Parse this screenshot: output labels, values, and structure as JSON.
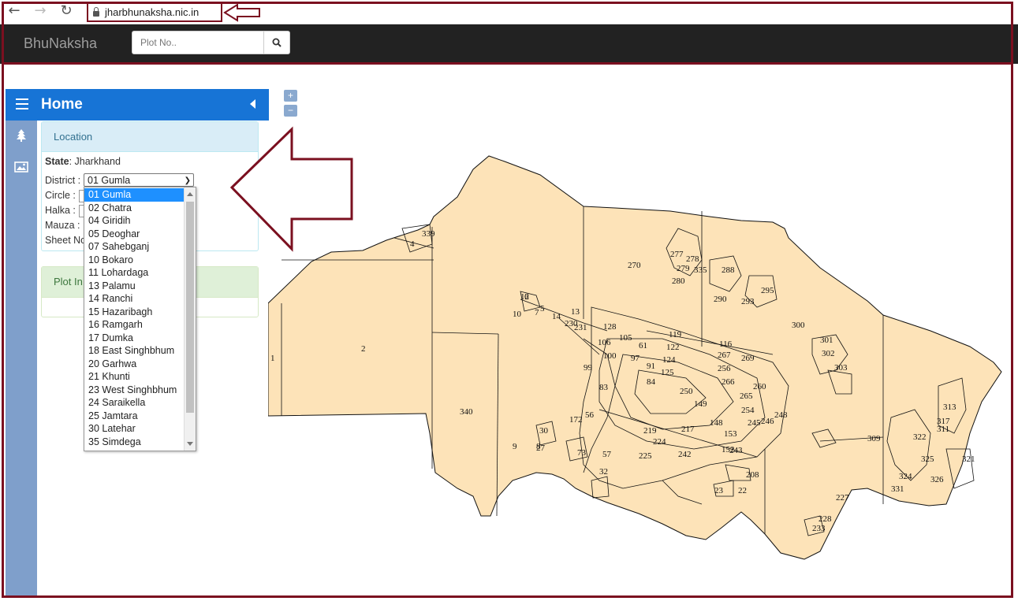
{
  "browser": {
    "url": "jharbhunaksha.nic.in"
  },
  "app": {
    "brand": "BhuNaksha",
    "search_placeholder": "Plot No.."
  },
  "sidebar": {
    "title": "Home",
    "location_panel": {
      "title": "Location",
      "state_label": "State",
      "state_value": ": Jharkhand",
      "district_label": "District :",
      "circle_label": "Circle :",
      "halka_label": "Halka :",
      "mauza_label": "Mauza :",
      "sheet_label": "Sheet No"
    },
    "plot_panel": {
      "title": "Plot In"
    }
  },
  "district_select": {
    "selected": "01 Gumla",
    "options": [
      "01 Gumla",
      "02 Chatra",
      "04 Giridih",
      "05 Deoghar",
      "07 Sahebganj",
      "10 Bokaro",
      "11 Lohardaga",
      "13 Palamu",
      "14 Ranchi",
      "15 Hazaribagh",
      "16 Ramgarh",
      "17 Dumka",
      "18 East Singhbhum",
      "20 Garhwa",
      "21 Khunti",
      "23 West Singhbhum",
      "24 Saraikella",
      "25 Jamtara",
      "30 Latehar",
      "35 Simdega"
    ]
  },
  "map": {
    "zoom_in": "+",
    "zoom_out": "−",
    "fill_color": "#fde3b8",
    "plot_labels": [
      "1",
      "2",
      "4",
      "339",
      "340",
      "270",
      "300",
      "301",
      "302",
      "303",
      "309",
      "311",
      "322",
      "325",
      "326",
      "321",
      "324",
      "331",
      "317",
      "313",
      "277",
      "278",
      "279",
      "335",
      "280",
      "288",
      "290",
      "293",
      "295",
      "119",
      "122",
      "124",
      "125",
      "128",
      "105",
      "106",
      "100",
      "99",
      "97",
      "91",
      "84",
      "83",
      "61",
      "116",
      "267",
      "269",
      "256",
      "266",
      "265",
      "260",
      "254",
      "245",
      "246",
      "248",
      "250",
      "149",
      "148",
      "153",
      "152",
      "243",
      "242",
      "224",
      "225",
      "219",
      "217",
      "172",
      "56",
      "73",
      "57",
      "32",
      "30",
      "27",
      "22",
      "23",
      "208",
      "227",
      "228",
      "233",
      "230",
      "231",
      "13",
      "14",
      "12",
      "10",
      "6",
      "5",
      "7",
      "9",
      "8"
    ]
  },
  "colors": {
    "accent": "#1774d6",
    "appbar": "#222222",
    "frame": "#7b1020",
    "strip": "#7f9fcb"
  }
}
